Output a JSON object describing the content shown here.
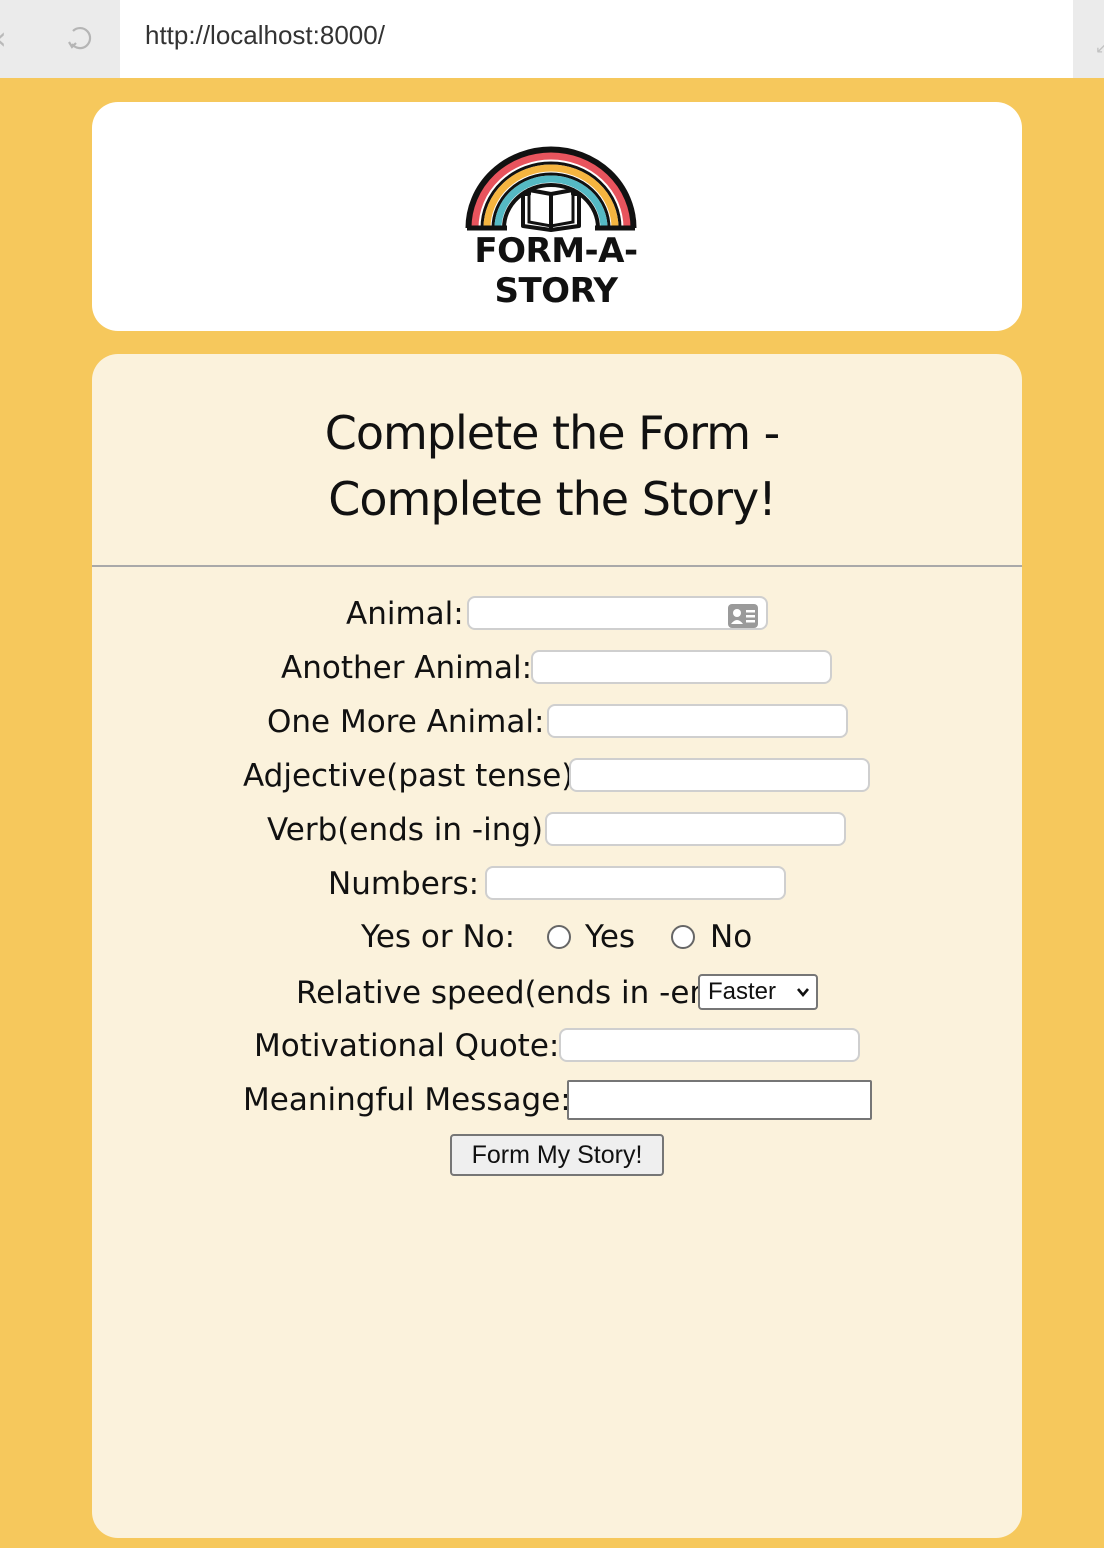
{
  "browser": {
    "url": "http://localhost:8000/"
  },
  "logo": {
    "text": "FORM-A-STORY",
    "colors": {
      "outer": "#e8545d",
      "middle": "#f5b540",
      "inner": "#55b9c4",
      "outline": "#111111"
    }
  },
  "form": {
    "title_line1": "Complete the Form -",
    "title_line2": "Complete the Story!",
    "fields": {
      "animal": {
        "label": "Animal:",
        "value": ""
      },
      "another_animal": {
        "label": "Another Animal:",
        "value": ""
      },
      "one_more_animal": {
        "label": "One More Animal:",
        "value": ""
      },
      "adjective": {
        "label": "Adjective(past tense):",
        "value": ""
      },
      "verb": {
        "label": "Verb(ends in -ing):",
        "value": ""
      },
      "numbers": {
        "label": "Numbers:",
        "value": ""
      },
      "yes_no": {
        "label": "Yes or No:",
        "yes_label": "Yes",
        "no_label": "No",
        "selected": null
      },
      "relative_speed": {
        "label": "Relative speed(ends in -er)",
        "selected": "Faster"
      },
      "motivational_quote": {
        "label": "Motivational Quote:",
        "value": ""
      },
      "meaningful_message": {
        "label": "Meaningful Message:",
        "value": ""
      }
    },
    "submit_label": "Form My Story!"
  },
  "colors": {
    "page_background": "#f6c85c",
    "header_card": "#ffffff",
    "form_card": "#fbf2dc"
  }
}
